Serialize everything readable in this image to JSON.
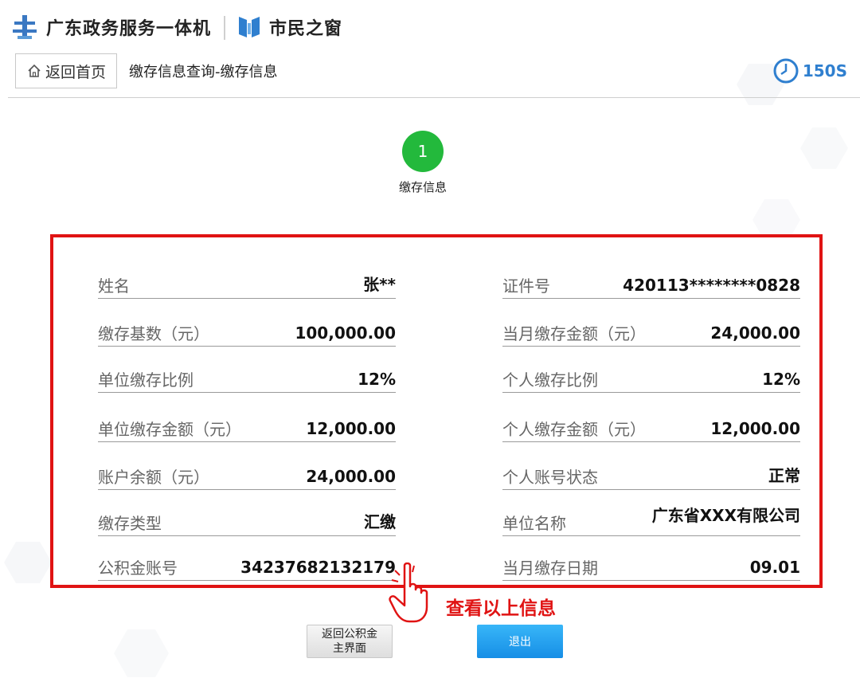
{
  "header": {
    "brand_primary": "广东政务服务一体机",
    "brand_secondary": "市民之窗"
  },
  "nav": {
    "home_label": "返回首页",
    "breadcrumb": "缴存信息查询-缴存信息",
    "timer": "150S"
  },
  "step": {
    "number": "1",
    "label": "缴存信息"
  },
  "info": {
    "left": [
      {
        "label": "姓名",
        "value": "张**"
      },
      {
        "label": "缴存基数（元）",
        "value": "100,000.00"
      },
      {
        "label": "单位缴存比例",
        "value": "12%"
      },
      {
        "label": "单位缴存金额（元）",
        "value": "12,000.00"
      },
      {
        "label": "账户余额（元）",
        "value": "24,000.00"
      },
      {
        "label": "缴存类型",
        "value": "汇缴"
      },
      {
        "label": "公积金账号",
        "value": "34237682132179"
      }
    ],
    "right": [
      {
        "label": "证件号",
        "value": "420113********0828"
      },
      {
        "label": "当月缴存金额（元）",
        "value": "24,000.00"
      },
      {
        "label": "个人缴存比例",
        "value": "12%"
      },
      {
        "label": "个人缴存金额（元）",
        "value": "12,000.00"
      },
      {
        "label": "个人账号状态",
        "value": "正常"
      },
      {
        "label": "单位名称",
        "value": "广东省XXX有限公司"
      },
      {
        "label": "当月缴存日期",
        "value": "09.01"
      }
    ]
  },
  "annotation": {
    "text": "查看以上信息",
    "color": "#e01313"
  },
  "buttons": {
    "back_line1": "返回公积金",
    "back_line2": "主界面",
    "exit": "退出"
  },
  "colors": {
    "step_green": "#23b93c",
    "accent_blue": "#2f7fcf",
    "exit_blue": "#168ee6"
  }
}
